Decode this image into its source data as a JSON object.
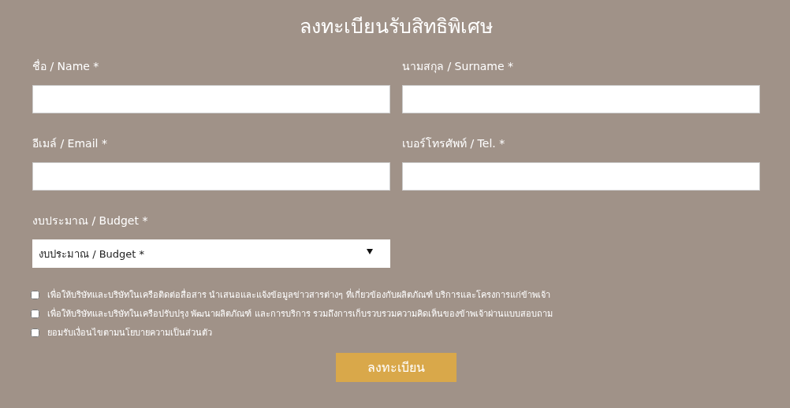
{
  "title": "ลงทะเบียนรับสิทธิพิเศษ",
  "fields": [
    {
      "label": "ชื่อ / Name *"
    },
    {
      "label": "นามสกุล / Surname *"
    },
    {
      "label": "อีเมล์ / Email *"
    },
    {
      "label": "เบอร์โทรศัพท์ / Tel. *"
    }
  ],
  "budget": {
    "label": "งบประมาณ / Budget *",
    "value": "งบประมาณ / Budget *"
  },
  "consents": [
    {
      "text": "เพื่อให้บริษัทและบริษัทในเครือติดต่อสื่อสาร นำเสนอและแจ้งข้อมูลข่าวสารต่างๆ ที่เกี่ยวข้องกับผลิตภัณฑ์ บริการและโครงการแก่ข้าพเจ้า",
      "checked": false
    },
    {
      "text": "เพื่อให้บริษัทและบริษัทในเครือปรับปรุง พัฒนาผลิตภัณฑ์ และการบริการ รวมถึงการเก็บรวบรวมความคิดเห็นของข้าพเจ้าผ่านแบบสอบถาม",
      "checked": false
    },
    {
      "text": "ยอมรับเงื่อนไขตามนโยบายความเป็นส่วนตัว",
      "checked": false
    }
  ],
  "submit": "ลงทะเบียน"
}
